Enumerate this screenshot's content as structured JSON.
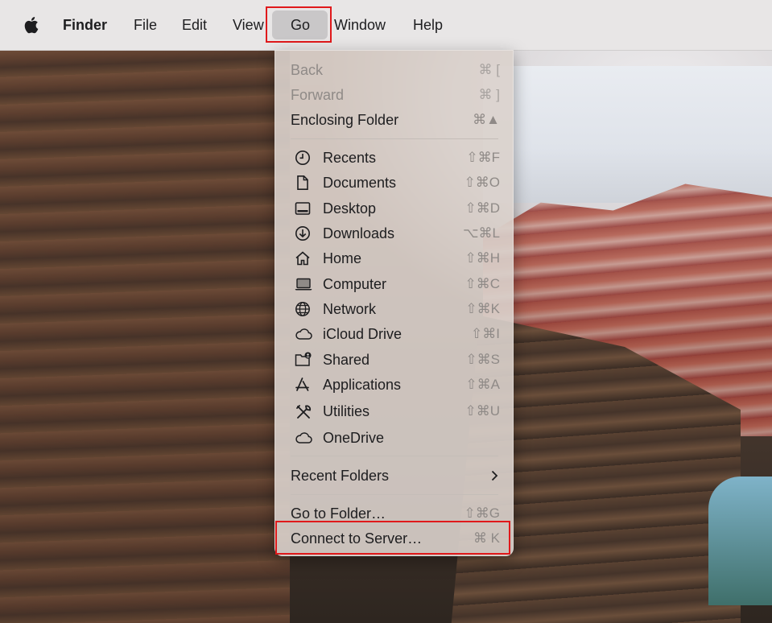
{
  "menubar": {
    "apple_icon": "apple-logo-icon",
    "items": [
      "Finder",
      "File",
      "Edit",
      "View",
      "Go",
      "Window",
      "Help"
    ]
  },
  "go_menu": {
    "nav": [
      {
        "label": "Back",
        "shortcut": "⌘ [",
        "enabled": false
      },
      {
        "label": "Forward",
        "shortcut": "⌘ ]",
        "enabled": false
      },
      {
        "label": "Enclosing Folder",
        "shortcut": "⌘▲",
        "enabled": true
      }
    ],
    "places": [
      {
        "label": "Recents",
        "shortcut": "⇧⌘F",
        "icon": "clock-icon"
      },
      {
        "label": "Documents",
        "shortcut": "⇧⌘O",
        "icon": "document-icon"
      },
      {
        "label": "Desktop",
        "shortcut": "⇧⌘D",
        "icon": "desktop-icon"
      },
      {
        "label": "Downloads",
        "shortcut": "⌥⌘L",
        "icon": "download-icon"
      },
      {
        "label": "Home",
        "shortcut": "⇧⌘H",
        "icon": "home-icon"
      },
      {
        "label": "Computer",
        "shortcut": "⇧⌘C",
        "icon": "laptop-icon"
      },
      {
        "label": "Network",
        "shortcut": "⇧⌘K",
        "icon": "globe-icon"
      },
      {
        "label": "iCloud Drive",
        "shortcut": "⇧⌘I",
        "icon": "cloud-icon"
      },
      {
        "label": "Shared",
        "shortcut": "⇧⌘S",
        "icon": "shared-folder-icon"
      },
      {
        "label": "Applications",
        "shortcut": "⇧⌘A",
        "icon": "applications-icon"
      },
      {
        "label": "Utilities",
        "shortcut": "⇧⌘U",
        "icon": "tools-icon"
      },
      {
        "label": "OneDrive",
        "shortcut": "",
        "icon": "cloud-icon"
      }
    ],
    "recent_folders": {
      "label": "Recent Folders",
      "icon": "chevron-right-icon"
    },
    "go_to_folder": {
      "label": "Go to Folder…",
      "shortcut": "⇧⌘G"
    },
    "connect_to_server": {
      "label": "Connect to Server…",
      "shortcut": "⌘ K"
    }
  },
  "colors": {
    "highlight_box": "#e0191b",
    "menubar_bg": "#e8e6e6",
    "menu_bg": "#dad2cc",
    "disabled_text": "#8f8a87"
  }
}
